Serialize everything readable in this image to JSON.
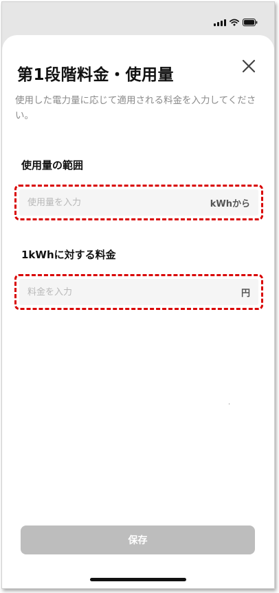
{
  "modal": {
    "title": "第1段階料金・使用量",
    "description": "使用した電力量に応じて適用される料金を入力してください。",
    "close_icon": "close-icon"
  },
  "usage_range": {
    "label": "使用量の範囲",
    "placeholder": "使用量を入力",
    "value": "",
    "unit": "kWhから"
  },
  "price_per_kwh": {
    "label": "1kWhに対する料金",
    "placeholder": "料金を入力",
    "value": "",
    "unit": "円"
  },
  "footer": {
    "save_label": "保存"
  },
  "status_bar": {
    "icons": [
      "signal-icon",
      "wifi-icon",
      "battery-icon"
    ]
  },
  "colors": {
    "highlight_border": "#d90000",
    "disabled_button": "#bdbdbd",
    "sheet_background": "#ffffff",
    "backdrop": "#e6e6e6"
  }
}
